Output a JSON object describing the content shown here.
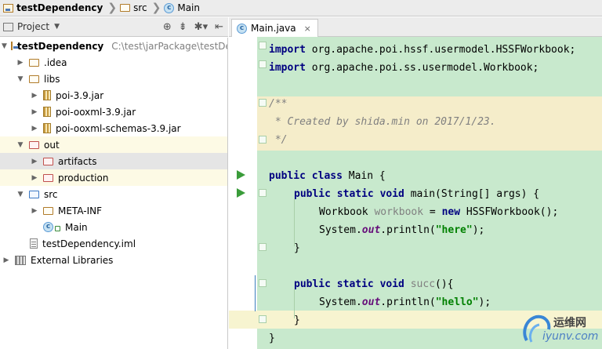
{
  "breadcrumb": {
    "items": [
      {
        "label": "testDependency",
        "icon": "module-icon"
      },
      {
        "label": "src",
        "icon": "folder-icon"
      },
      {
        "label": "Main",
        "icon": "class-icon"
      }
    ],
    "separator": "❯"
  },
  "project_panel": {
    "title": "Project",
    "tools": [
      "target-icon",
      "collapse-icon",
      "gear-icon",
      "hide-icon"
    ],
    "tree": [
      {
        "label": "testDependency",
        "path": "C:\\test\\jarPackage\\testDe",
        "expanded": true,
        "icon": "module-icon"
      },
      {
        "label": ".idea",
        "expanded": false,
        "icon": "folder-icon"
      },
      {
        "label": "libs",
        "expanded": true,
        "icon": "folder-icon"
      },
      {
        "label": "poi-3.9.jar",
        "expanded": false,
        "icon": "jar-icon"
      },
      {
        "label": "poi-ooxml-3.9.jar",
        "expanded": false,
        "icon": "jar-icon"
      },
      {
        "label": "poi-ooxml-schemas-3.9.jar",
        "expanded": false,
        "icon": "jar-icon"
      },
      {
        "label": "out",
        "expanded": true,
        "icon": "folder-icon"
      },
      {
        "label": "artifacts",
        "expanded": false,
        "icon": "folder-icon"
      },
      {
        "label": "production",
        "expanded": false,
        "icon": "folder-icon"
      },
      {
        "label": "src",
        "expanded": true,
        "icon": "source-folder-icon"
      },
      {
        "label": "META-INF",
        "expanded": false,
        "icon": "folder-icon"
      },
      {
        "label": "Main",
        "icon": "class-icon"
      },
      {
        "label": "testDependency.iml",
        "icon": "iml-file-icon"
      },
      {
        "label": "External Libraries",
        "expanded": false,
        "icon": "libraries-icon"
      }
    ]
  },
  "editor": {
    "tab": {
      "label": "Main.java",
      "close": "×"
    },
    "code": {
      "import1": {
        "kw": "import",
        "rest": " org.apache.poi.hssf.usermodel.HSSFWorkbook;"
      },
      "import2": {
        "kw": "import",
        "rest": " org.apache.poi.ss.usermodel.Workbook;"
      },
      "comment1": "/**",
      "comment2": " * Created by shida.min on 2017/1/23.",
      "comment3": " */",
      "class_kw": "public class",
      "class_rest": " Main {",
      "main_kw": "public static void",
      "main_rest": " main(String[] args) {",
      "wb_type": "Workbook ",
      "wb_var": "workbook",
      "wb_eq": " = ",
      "wb_new": "new",
      "wb_rest": " HSSFWorkbook();",
      "print1_pre": "System.",
      "print1_out": "out",
      "print1_mid": ".println(",
      "print1_str": "\"here\"",
      "print1_end": ");",
      "close_brace": "}",
      "succ_kw": "public static void",
      "succ_name": "succ",
      "succ_rest": "(){",
      "print2_pre": "System.",
      "print2_out": "out",
      "print2_mid": ".println(",
      "print2_str": "\"hello\"",
      "print2_end": ");",
      "close_brace2": "}",
      "close_brace3": "}"
    }
  },
  "watermark": {
    "cn": "运维网",
    "url": "iyunv.com"
  }
}
